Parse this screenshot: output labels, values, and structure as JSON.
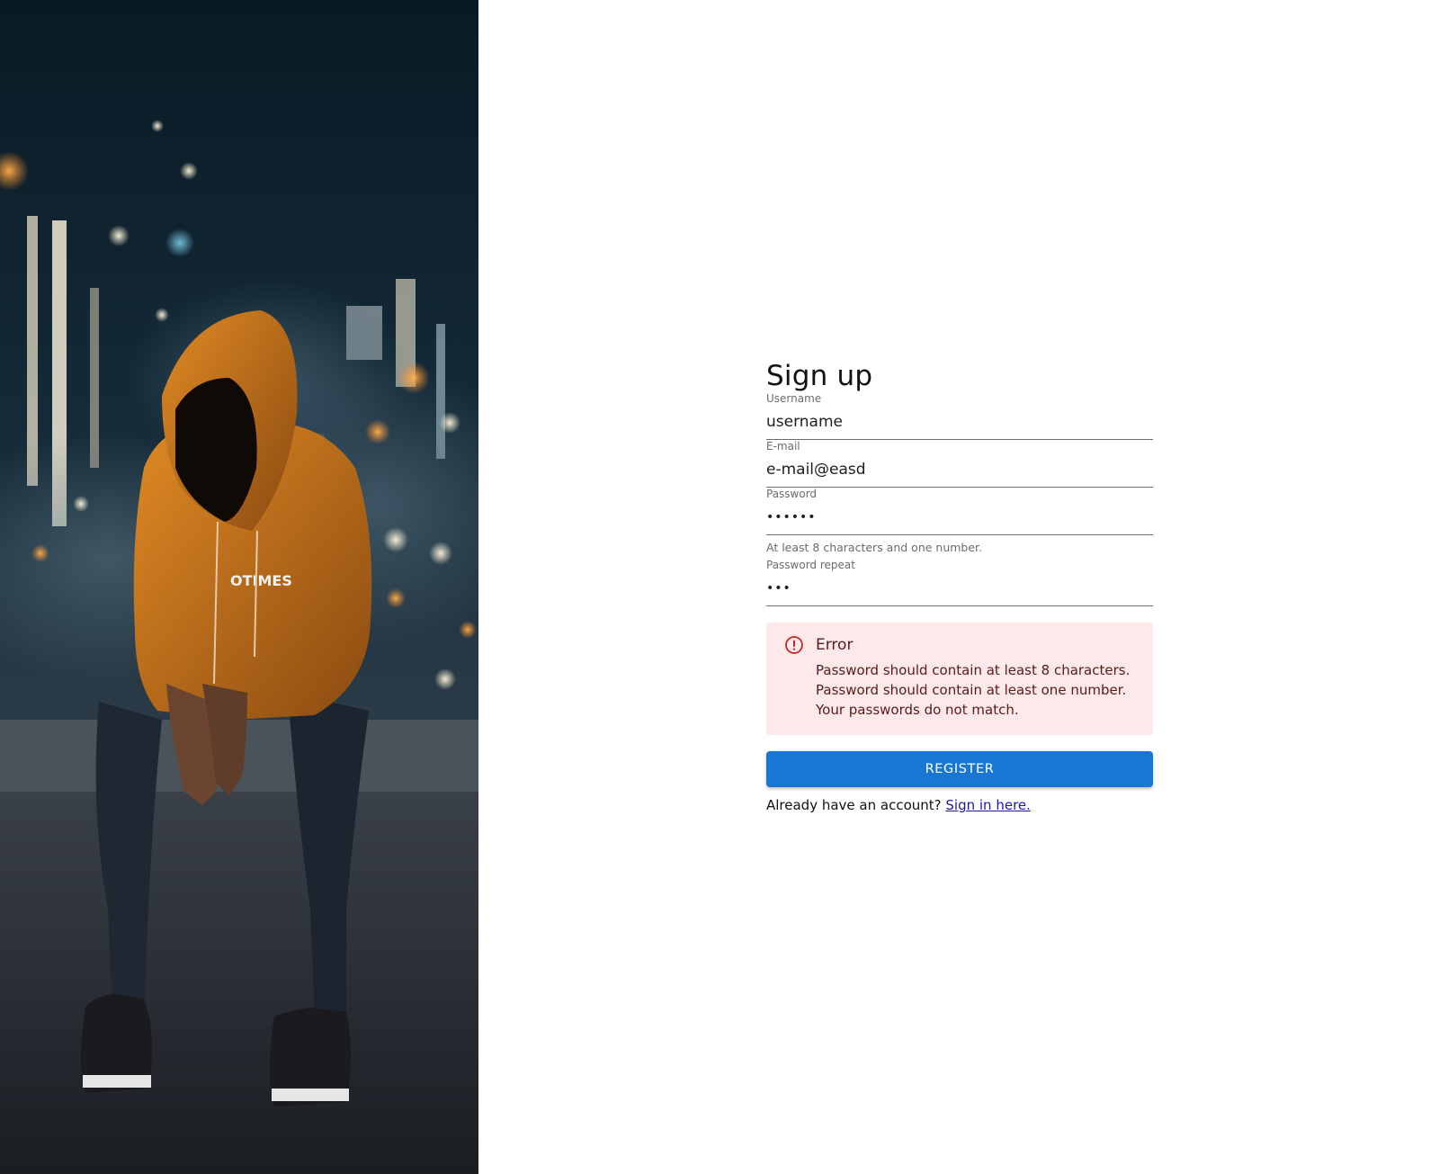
{
  "hero": {
    "image_icon": "hooded-person-city-night-photo",
    "hoodie_print": "OTIMES"
  },
  "form": {
    "title": "Sign up",
    "username": {
      "label": "Username",
      "value": "username"
    },
    "email": {
      "label": "E-mail",
      "value": "e-mail@easd"
    },
    "password": {
      "label": "Password",
      "value": "123456",
      "helper": "At least 8 characters and one number."
    },
    "password_repeat": {
      "label": "Password repeat",
      "value": "123"
    },
    "error": {
      "icon": "error-circle-icon",
      "title": "Error",
      "messages": [
        "Password should contain at least 8 characters.",
        "Password should contain at least one number.",
        "Your passwords do not match."
      ]
    },
    "register_label": "REGISTER",
    "signin_prompt": "Already have an account?",
    "signin_link": "Sign in here."
  },
  "colors": {
    "primary": "#1976d2",
    "error_bg": "#fde9e9",
    "error_icon": "#c62828",
    "hoodie": "#c9731d"
  }
}
